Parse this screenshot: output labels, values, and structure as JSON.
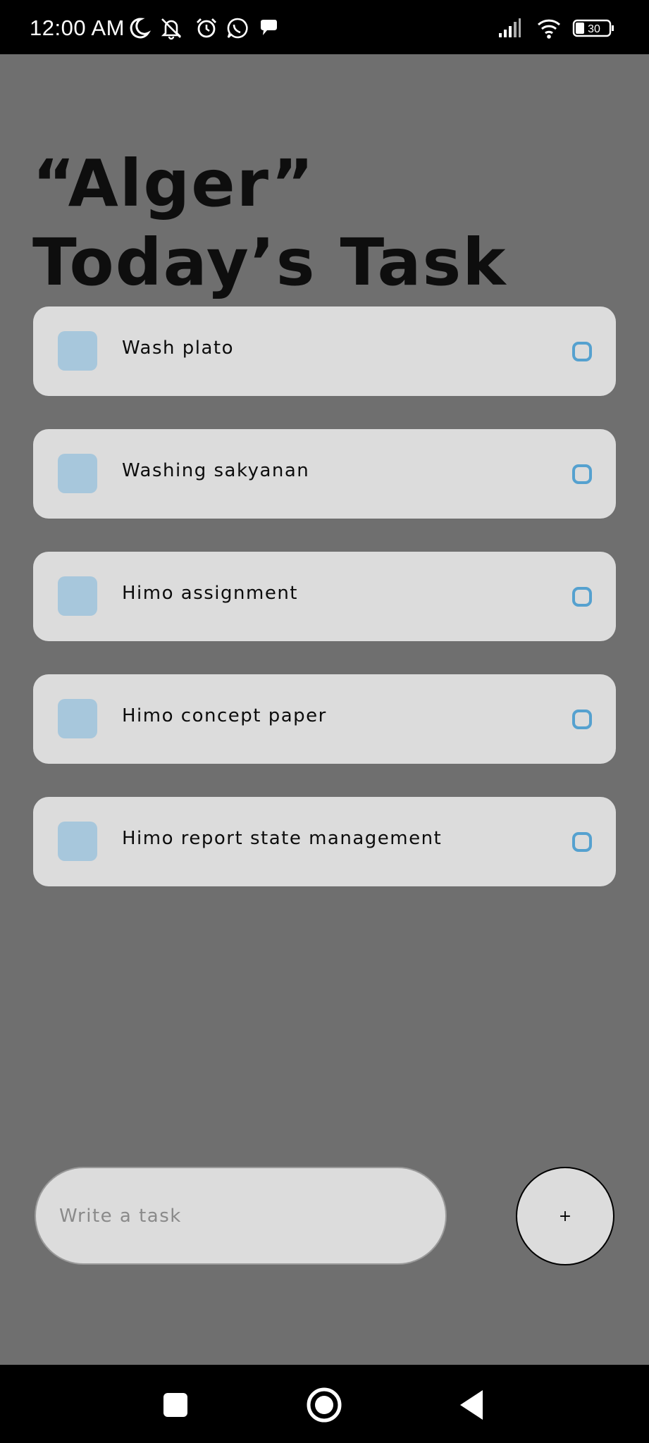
{
  "status_bar": {
    "time": "12:00 AM",
    "left_icons": [
      "moon-icon",
      "bell-off-icon",
      "alarm-icon",
      "whatsapp-icon",
      "chat-icon"
    ],
    "right_icons": [
      "signal-icon",
      "wifi-icon",
      "battery-icon"
    ],
    "battery_level": "30"
  },
  "header": {
    "title": "“Alger” Today’s Task"
  },
  "tasks": [
    {
      "label": "Wash plato"
    },
    {
      "label": "Washing sakyanan"
    },
    {
      "label": "Himo assignment"
    },
    {
      "label": "Himo concept paper"
    },
    {
      "label": "Himo report state management"
    }
  ],
  "composer": {
    "placeholder": "Write a task",
    "add_label": "+"
  },
  "nav_bar": {
    "buttons": [
      "recents-icon",
      "home-icon",
      "back-icon"
    ]
  },
  "colors": {
    "background": "#6f6f6f",
    "card": "#dcdcdc",
    "square": "#a7c7dc",
    "circle_accent": "#55a1cf"
  }
}
